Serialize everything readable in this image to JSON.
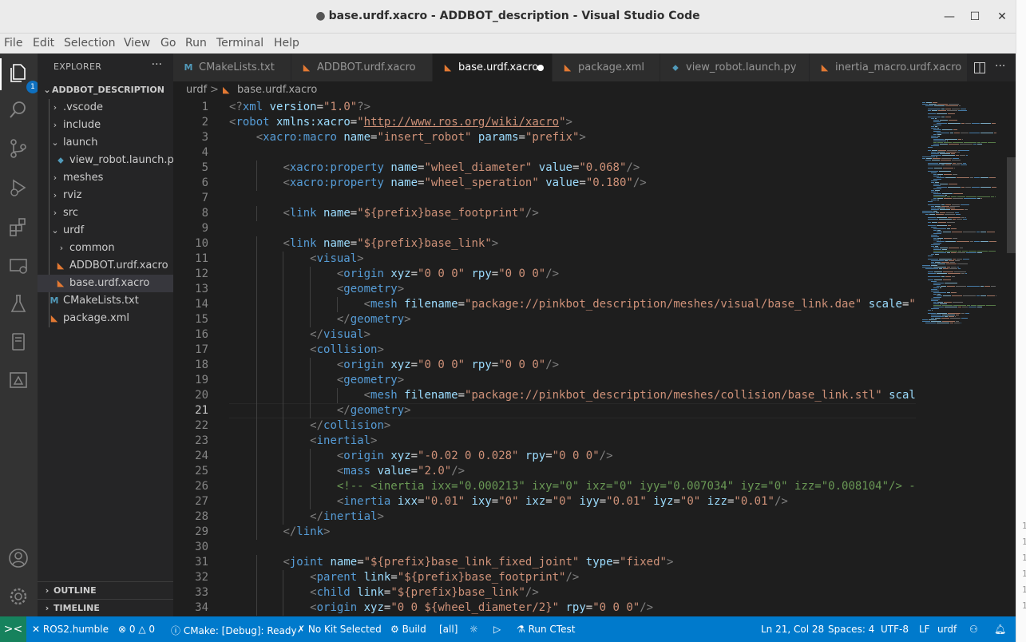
{
  "window": {
    "title": "base.urdf.xacro - ADDBOT_description - Visual Studio Code",
    "controls": [
      "minimize-icon",
      "maximize-icon",
      "close-icon"
    ]
  },
  "menu": [
    "File",
    "Edit",
    "Selection",
    "View",
    "Go",
    "Run",
    "Terminal",
    "Help"
  ],
  "activity_bar": {
    "items": [
      "explorer-icon",
      "search-icon",
      "source-control-icon",
      "run-debug-icon",
      "extensions-icon",
      "remote-explorer-icon",
      "testing-icon",
      "ros-icon",
      "cmake-icon"
    ],
    "bottom": [
      "account-icon",
      "manage-gear-icon"
    ],
    "explorer_badge": "1"
  },
  "sidebar": {
    "header": "EXPLORER",
    "more": "···",
    "root": "ADDBOT_DESCRIPTION",
    "items": [
      {
        "label": ".vscode",
        "kind": "folder",
        "expanded": false
      },
      {
        "label": "include",
        "kind": "folder",
        "expanded": false
      },
      {
        "label": "launch",
        "kind": "folder",
        "expanded": true
      },
      {
        "label": "view_robot.launch.py",
        "kind": "python"
      },
      {
        "label": "meshes",
        "kind": "folder",
        "expanded": false
      },
      {
        "label": "rviz",
        "kind": "folder",
        "expanded": false
      },
      {
        "label": "src",
        "kind": "folder",
        "expanded": false
      },
      {
        "label": "urdf",
        "kind": "folder",
        "expanded": true
      },
      {
        "label": "common",
        "kind": "folder",
        "expanded": false
      },
      {
        "label": "ADDBOT.urdf.xacro",
        "kind": "xml"
      },
      {
        "label": "base.urdf.xacro",
        "kind": "xml",
        "selected": true
      },
      {
        "label": "CMakeLists.txt",
        "kind": "cmake"
      },
      {
        "label": "package.xml",
        "kind": "xml"
      }
    ],
    "outline": "OUTLINE",
    "timeline": "TIMELINE"
  },
  "tabs": [
    {
      "label": "CMakeLists.txt",
      "icon": "M"
    },
    {
      "label": "ADDBOT.urdf.xacro",
      "icon": "rss"
    },
    {
      "label": "base.urdf.xacro",
      "icon": "rss",
      "active": true,
      "dirty": true
    },
    {
      "label": "package.xml",
      "icon": "rss"
    },
    {
      "label": "view_robot.launch.py",
      "icon": "py"
    },
    {
      "label": "inertia_macro.urdf.xacro",
      "icon": "rss"
    }
  ],
  "breadcrumb": {
    "folder": "urdf",
    "sep": ">",
    "file": "base.urdf.xacro"
  },
  "editor": {
    "current_line": 21,
    "lines": [
      "<?xml version=\"1.0\"?>",
      "<robot xmlns:xacro=\"http://www.ros.org/wiki/xacro\">",
      "    <xacro:macro name=\"insert_robot\" params=\"prefix\">",
      "",
      "        <xacro:property name=\"wheel_diameter\" value=\"0.068\"/>",
      "        <xacro:property name=\"wheel_speration\" value=\"0.180\"/>",
      "",
      "        <link name=\"${prefix}base_footprint\"/>",
      "",
      "        <link name=\"${prefix}base_link\">",
      "            <visual>",
      "                <origin xyz=\"0 0 0\" rpy=\"0 0 0\"/>",
      "                <geometry>",
      "                    <mesh filename=\"package://pinkbot_description/meshes/visual/base_link.dae\" scale=\"",
      "                </geometry>",
      "            </visual>",
      "            <collision>",
      "                <origin xyz=\"0 0 0\" rpy=\"0 0 0\"/>",
      "                <geometry>",
      "                    <mesh filename=\"package://pinkbot_description/meshes/collision/base_link.stl\" scale",
      "                </geometry>",
      "            </collision>",
      "            <inertial>",
      "                <origin xyz=\"-0.02 0 0.028\" rpy=\"0 0 0\"/>",
      "                <mass value=\"2.0\"/>",
      "                <!-- <inertia ixx=\"0.000213\" ixy=\"0\" ixz=\"0\" iyy=\"0.007034\" iyz=\"0\" izz=\"0.008104\"/> -",
      "                <inertia ixx=\"0.01\" ixy=\"0\" ixz=\"0\" iyy=\"0.01\" iyz=\"0\" izz=\"0.01\"/>",
      "            </inertial>",
      "        </link>",
      "",
      "        <joint name=\"${prefix}base_link_fixed_joint\" type=\"fixed\">",
      "            <parent link=\"${prefix}base_footprint\"/>",
      "            <child link=\"${prefix}base_link\"/>",
      "            <origin xyz=\"0 0 ${wheel_diameter/2}\" rpy=\"0 0 0\"/>"
    ]
  },
  "status": {
    "remote": "><",
    "ros": "ROS2.humble",
    "errors": "0",
    "warnings": "0",
    "cmake": "CMake: [Debug]: Ready",
    "kit": "No Kit Selected",
    "build": "Build",
    "target": "[all]",
    "ctest": "Run CTest",
    "position": "Ln 21, Col 28",
    "spaces": "Spaces: 4",
    "encoding": "UTF-8",
    "eol": "LF",
    "language": "urdf"
  },
  "colors": {
    "status_bar": "#007acc",
    "remote": "#16825d",
    "editor_bg": "#1e1e1e",
    "sidebar_bg": "#252526",
    "tag": "#569cd6",
    "attribute": "#9cdcfe",
    "string": "#ce9178",
    "comment": "#6a9955"
  }
}
